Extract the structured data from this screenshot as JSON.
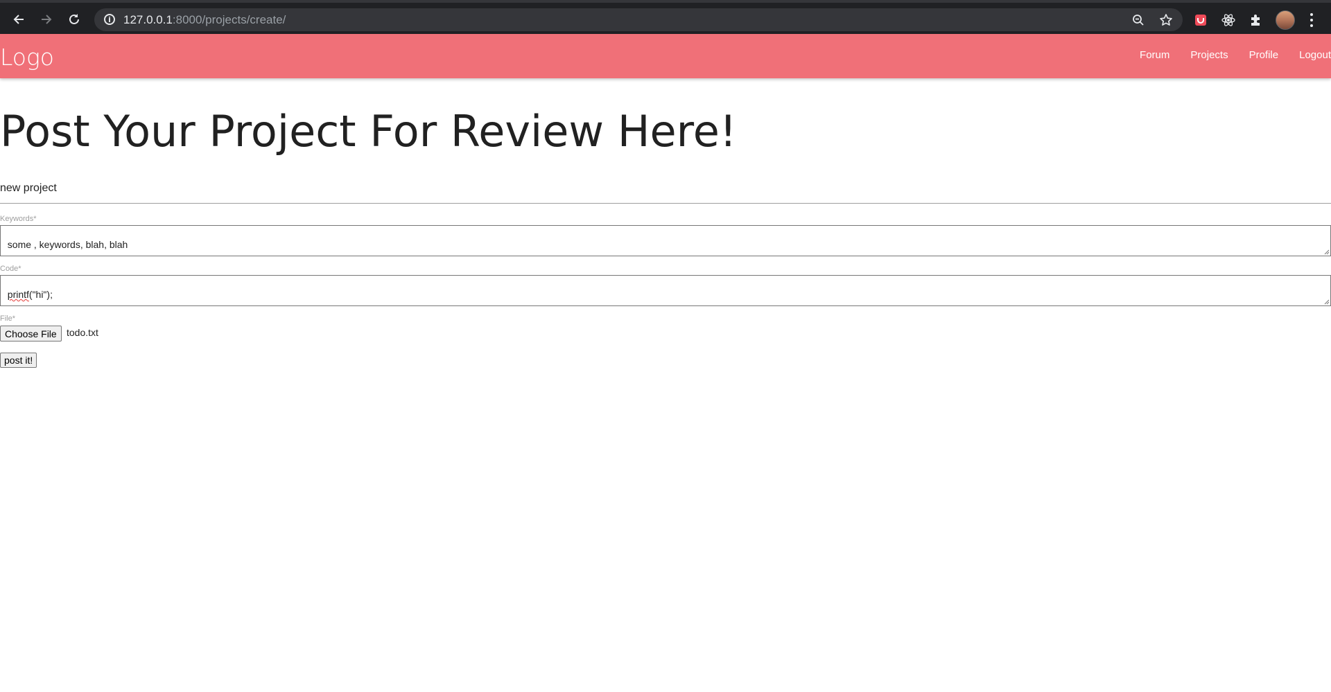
{
  "browser": {
    "url_host": "127.0.0.1",
    "url_rest": ":8000/projects/create/",
    "icons": {
      "back": "back-arrow-icon",
      "forward": "forward-arrow-icon",
      "reload": "reload-icon",
      "site_info": "info-icon",
      "zoom": "zoom-icon",
      "bookmark": "star-icon",
      "extensions": [
        "shield-extension-icon",
        "react-extension-icon",
        "puzzle-icon"
      ],
      "profile": "avatar",
      "menu": "kebab-menu-icon"
    }
  },
  "navbar": {
    "brand": "Logo",
    "links": [
      "Forum",
      "Projects",
      "Profile",
      "Logout"
    ],
    "color": "#f07078"
  },
  "page": {
    "title": "Post Your Project For Review Here!",
    "section_label": "new project",
    "form": {
      "keywords": {
        "label": "Keywords*",
        "value": "some , keywords, blah, blah"
      },
      "code": {
        "label": "Code*",
        "value_misspelled": "printf",
        "value_rest": "(\"hi\");"
      },
      "file": {
        "label": "File*",
        "button_label": "Choose File",
        "file_name": "todo.txt"
      },
      "submit_label": "post it!"
    }
  }
}
